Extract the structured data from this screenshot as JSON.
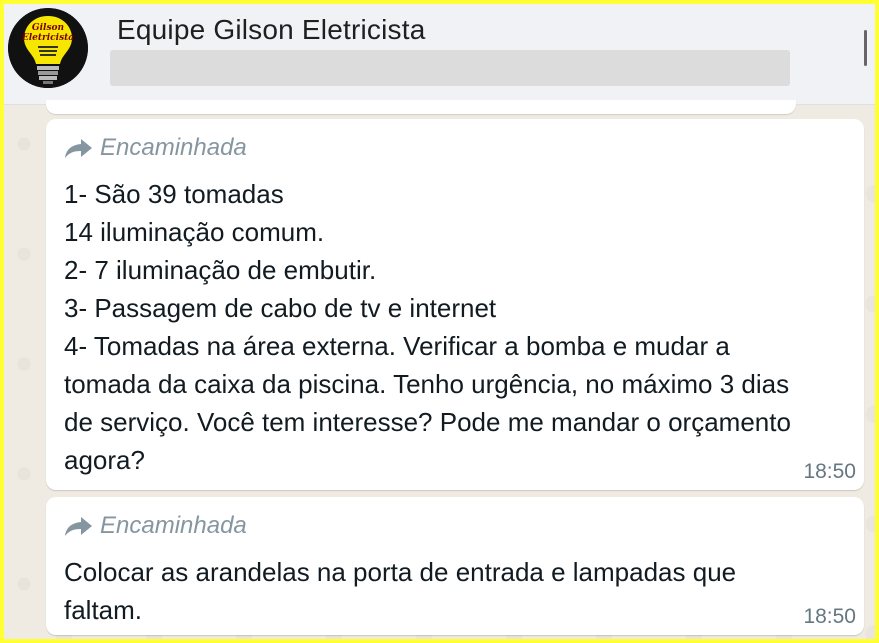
{
  "header": {
    "contact_name": "Equipe Gilson Eletricista",
    "avatar_text_line1": "Gilson",
    "avatar_text_line2": "Eletricista"
  },
  "messages": [
    {
      "forwarded_label": "Encaminhada",
      "text": "1- São 39 tomadas\n14 iluminação comum.\n2- 7 iluminação de embutir.\n3- Passagem de cabo de tv e internet\n4- Tomadas na área externa. Verificar a bomba e mudar a\ntomada da caixa da piscina. Tenho urgência, no máximo 3 dias\nde serviço. Você tem interesse? Pode me mandar o orçamento\nagora?",
      "time": "18:50"
    },
    {
      "forwarded_label": "Encaminhada",
      "text": "Colocar as arandelas na porta de entrada e lampadas que\nfaltam.",
      "time": "18:50"
    }
  ],
  "colors": {
    "border": "#ffff33",
    "header_bg": "#f0f2f5",
    "chat_bg": "#efeae2",
    "bubble_bg": "#ffffff",
    "meta_text": "#8696a0"
  },
  "icons": {
    "forward": "forward-arrow-icon",
    "avatar": "lightbulb-logo"
  }
}
